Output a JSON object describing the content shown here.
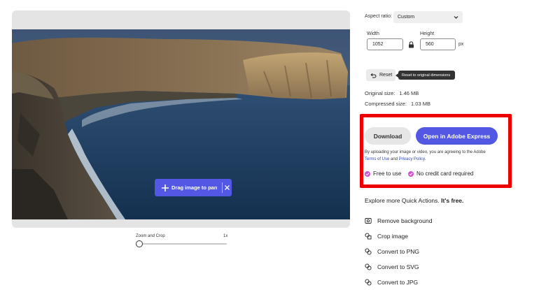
{
  "canvas": {
    "toast": {
      "label": "Drag image to pan"
    }
  },
  "zoom": {
    "label": "Zoom and Crop",
    "value": "1x",
    "level": 0
  },
  "aspect_ratio": {
    "label": "Aspect ratio:",
    "value": "Custom"
  },
  "dimensions": {
    "width_label": "Width",
    "width_value": "1052",
    "height_label": "Height",
    "height_value": "560",
    "unit": "px"
  },
  "reset": {
    "label": "Reset",
    "tooltip": "Reset to original dimensions"
  },
  "sizes": {
    "original_label": "Original size:",
    "original_value": "1.46 MB",
    "compressed_label": "Compressed size:",
    "compressed_value": "1.03 MB"
  },
  "actions": {
    "download_label": "Download",
    "express_label": "Open in Adobe Express",
    "consent_prefix": "By uploading your image or video, you are agreeing to the Adobe",
    "terms_link": "Terms of Use",
    "consent_and": "and",
    "privacy_link": "Privacy Policy",
    "consent_end": ".",
    "perk_free": "Free to use",
    "perk_no_card": "No credit card required"
  },
  "explore": {
    "prefix": "Explore more Quick Actions.",
    "emphasis": "It's free.",
    "items": [
      {
        "label": "Remove background",
        "icon": "remove-background-icon"
      },
      {
        "label": "Crop image",
        "icon": "crop-icon"
      },
      {
        "label": "Convert to PNG",
        "icon": "convert-icon"
      },
      {
        "label": "Convert to SVG",
        "icon": "convert-icon"
      },
      {
        "label": "Convert to JPG",
        "icon": "convert-icon"
      }
    ]
  },
  "colors": {
    "accent": "#5258e4",
    "highlight": "#ee0000",
    "check": "#d24fd6",
    "link": "#2d48b5"
  }
}
